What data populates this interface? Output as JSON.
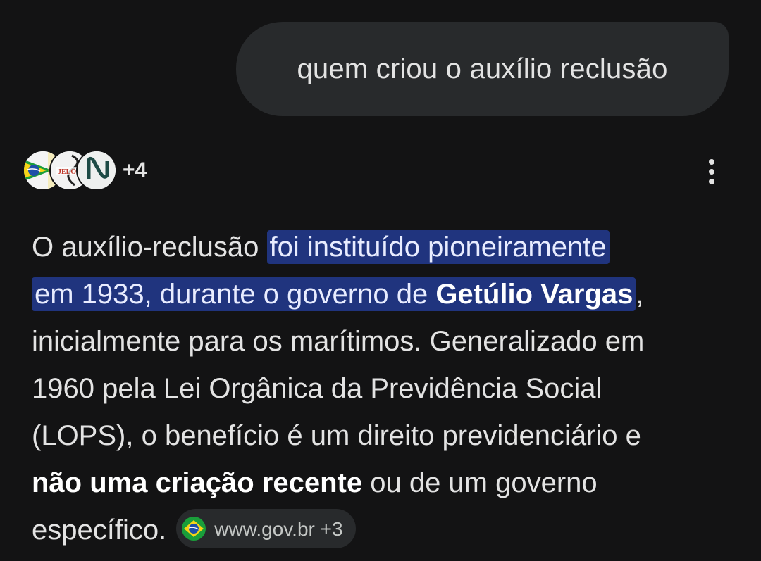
{
  "user_message": {
    "text": "quem criou o auxílio reclusão"
  },
  "sources": {
    "favicons": [
      "brazil-flag-icon",
      "jelo-logo-icon",
      "lens-logo-icon"
    ],
    "more_count": "+4"
  },
  "menu": {
    "icon": "more-vert-icon"
  },
  "answer": {
    "line1_plain": "O auxílio-reclusão",
    "line1_hl": "foi instituído pioneiramente",
    "line2_hl_pre": "em 1933, durante o governo de",
    "line2_hl_bold": "Getúlio Vargas",
    "line2_after": ",",
    "line3": "inicialmente para os marítimos. Generalizado em",
    "line4": "1960 pela Lei Orgânica da Previdência Social",
    "line5": "(LOPS), o benefício é um direito previdenciário e",
    "line6_bold": "não uma criação recente",
    "line6_rest": " ou de um governo",
    "line7": "específico."
  },
  "citation_chip": {
    "icon": "brazil-flag-icon",
    "label": "www.gov.br +3"
  },
  "colors": {
    "background": "#131314",
    "bubble": "#282a2c",
    "highlight": "#20347e",
    "text": "#e3e3e3"
  }
}
